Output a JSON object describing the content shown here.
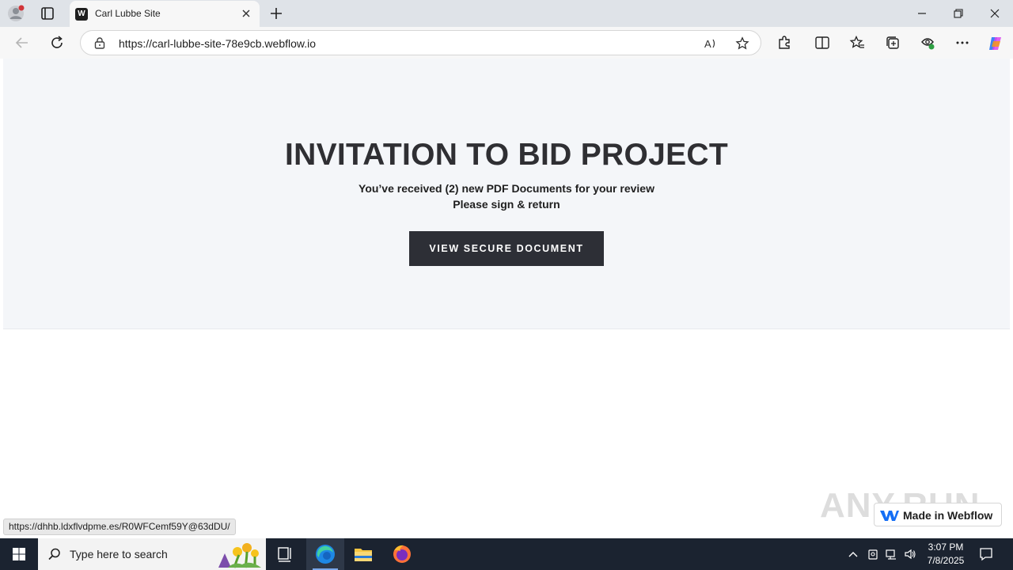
{
  "browser": {
    "tab_title": "Carl Lubbe Site",
    "url": "https://carl-lubbe-site-78e9cb.webflow.io",
    "status_url": "https://dhhb.ldxflvdpme.es/R0WFCemf59Y@63dDU/"
  },
  "page": {
    "heading": "INVITATION TO BID PROJECT",
    "line1": "You’ve received (2) new PDF Documents for your review",
    "line2": "Please sign & return",
    "cta_label": "VIEW SECURE DOCUMENT",
    "badge_label": "Made in Webflow",
    "watermark": "ANY.RUN"
  },
  "taskbar": {
    "search_placeholder": "Type here to search",
    "time": "3:07 PM",
    "date": "7/8/2025"
  },
  "colors": {
    "hero_bg": "#f4f6f9",
    "cta_bg": "#2d2f36",
    "taskbar_bg": "#1b2330",
    "heading": "#2f2f33"
  }
}
